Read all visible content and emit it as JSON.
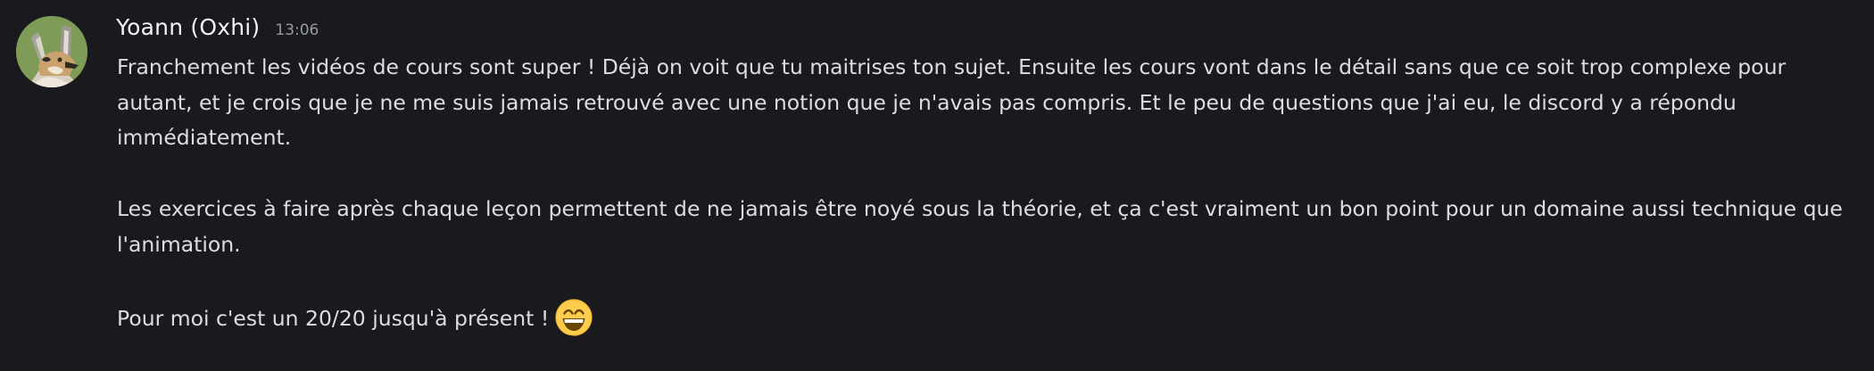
{
  "message": {
    "author": "Yoann (Oxhi)",
    "timestamp": "13:06",
    "avatar_icon": "fox-avatar-icon",
    "paragraphs": [
      "Franchement les vidéos de cours sont super ! Déjà on voit que tu maitrises ton sujet. Ensuite les cours vont dans le détail sans que ce soit trop complexe pour autant, et je crois que je ne me suis jamais retrouvé avec une notion que je n'avais pas compris. Et le peu de questions que j'ai eu, le discord y a répondu immédiatement.",
      "Les exercices à faire après chaque leçon permettent de ne jamais être noyé sous la théorie, et ça c'est vraiment un bon point pour un domaine aussi technique que l'animation.",
      "Pour moi c'est un 20/20 jusqu'à présent !"
    ],
    "emoji": "grinning-smiling-eyes-emoji"
  },
  "colors": {
    "background": "#1a1a1e",
    "username": "#f2f3f5",
    "timestamp": "#949ba4",
    "text": "#dbdee1",
    "avatar_background": "#7f9b58"
  }
}
